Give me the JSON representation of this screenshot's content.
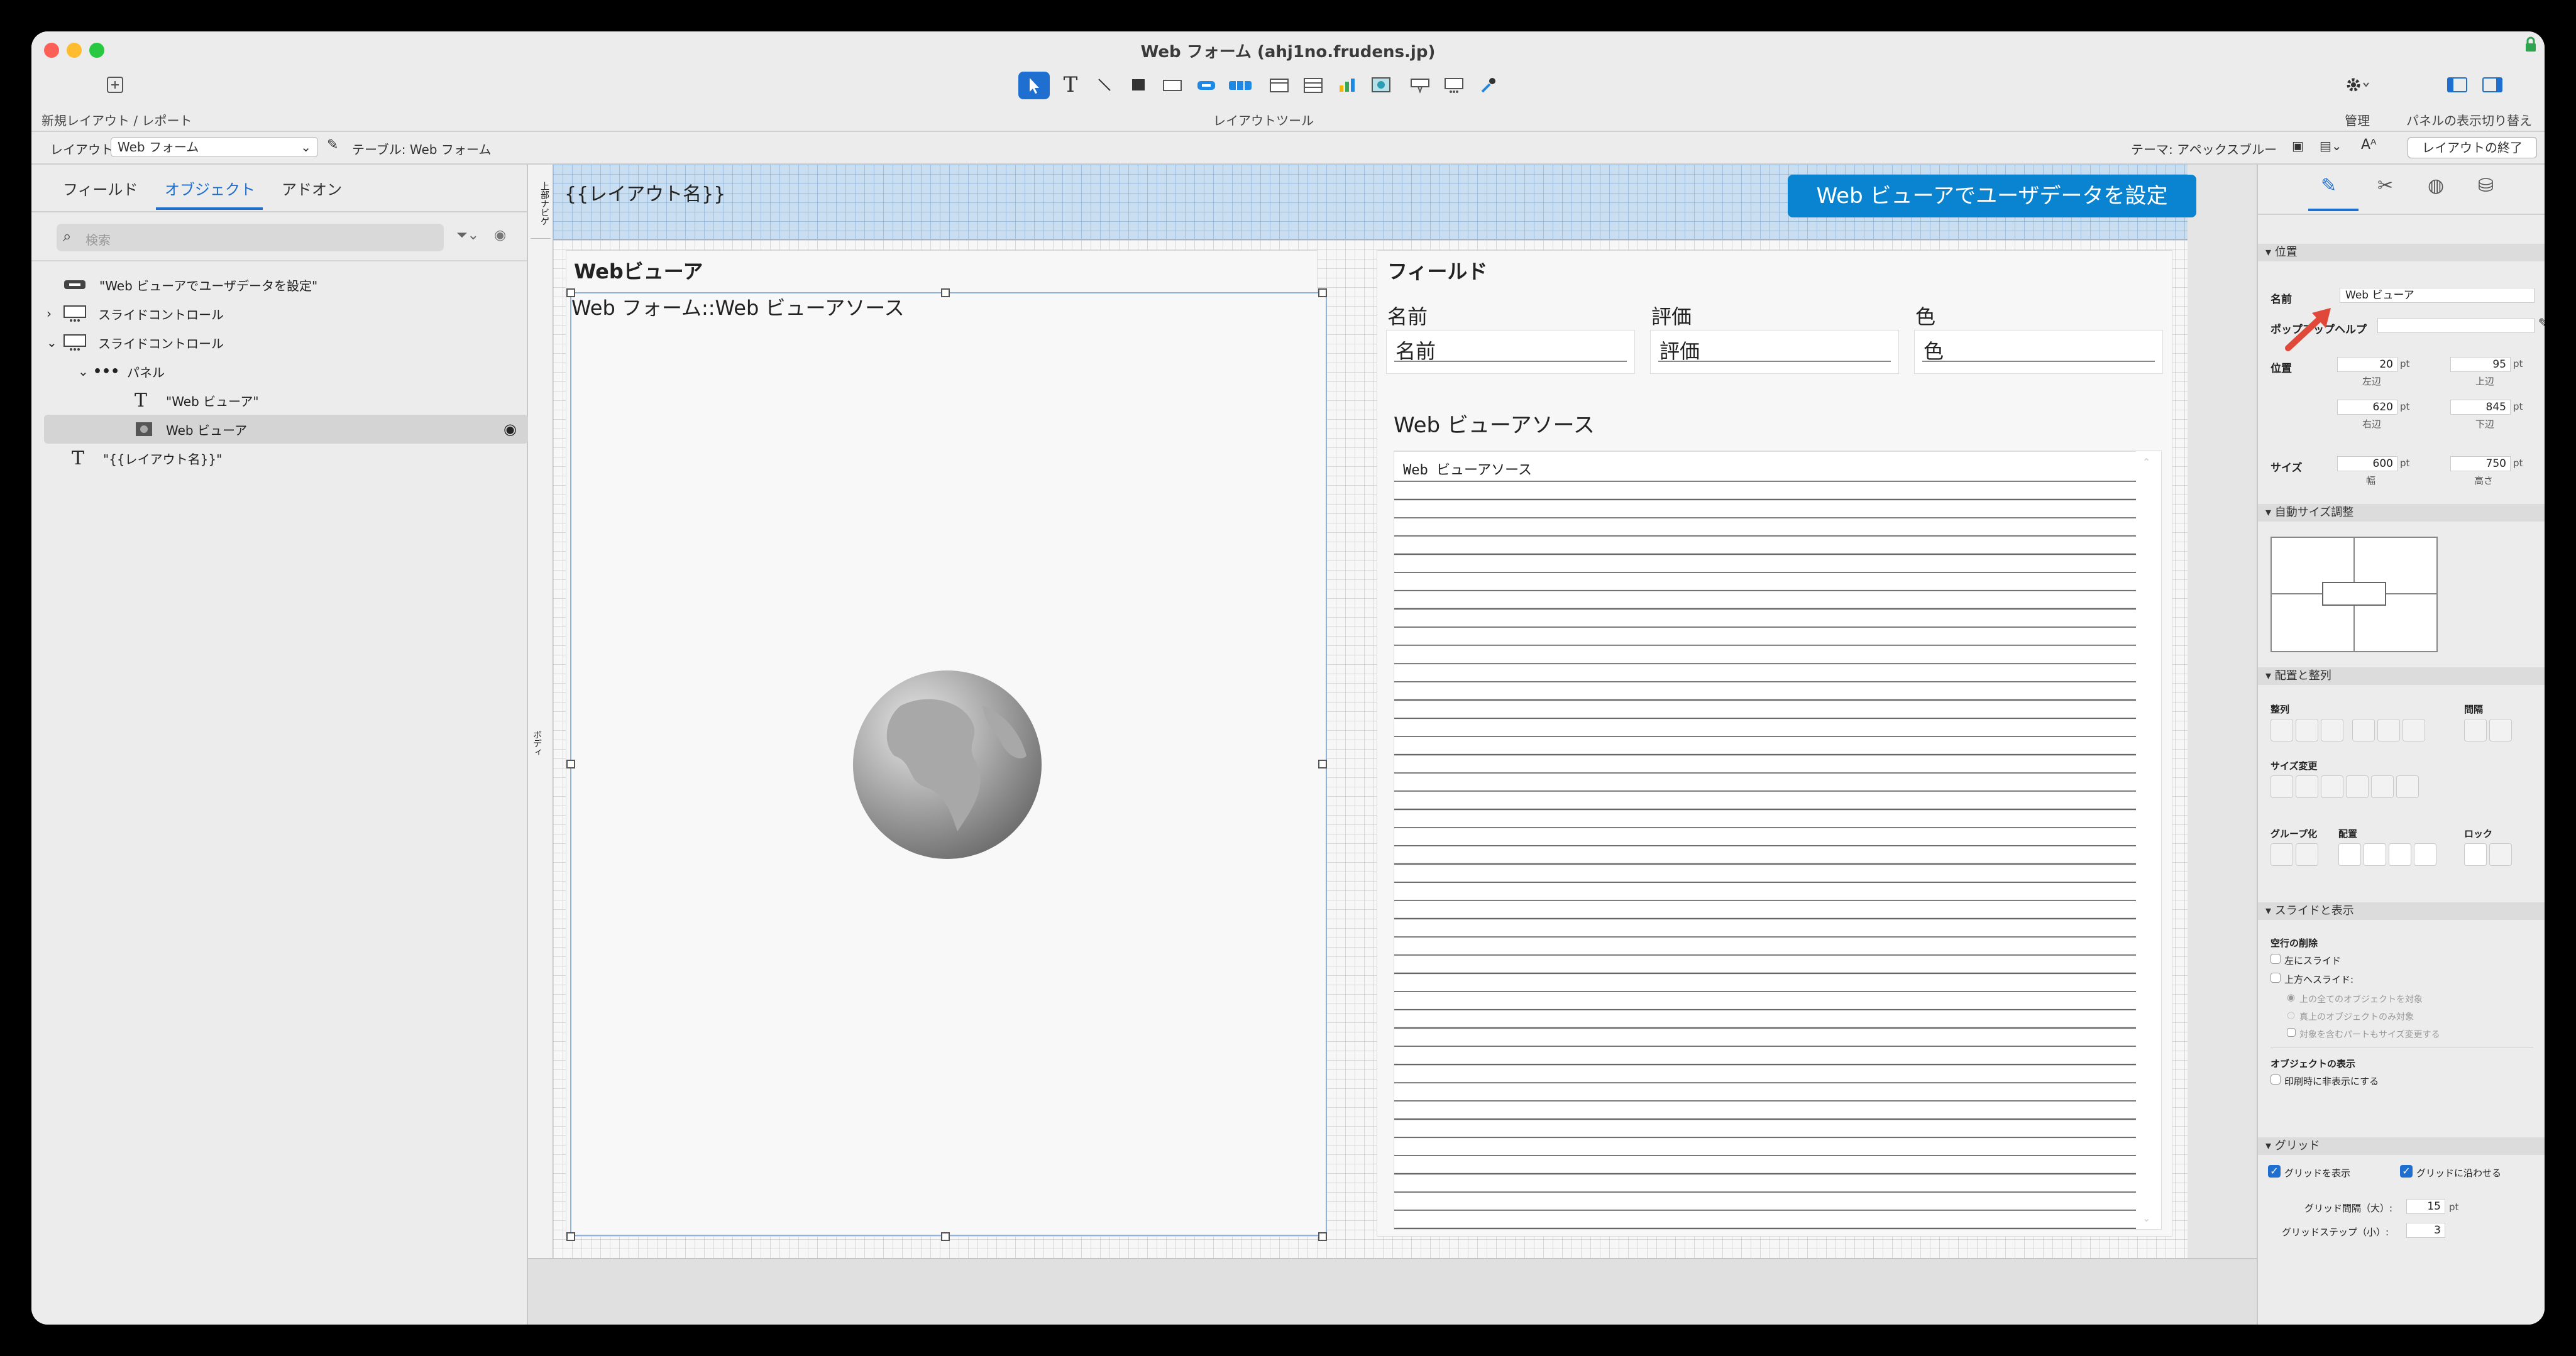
{
  "window": {
    "title": "Web フォーム (ahj1no.frudens.jp)",
    "new_layout_label": "新規レイアウト / レポート",
    "layout_tools_label": "レイアウトツール",
    "manage_label": "管理",
    "panel_toggle_label": "パネルの表示切り替え"
  },
  "layoutbar": {
    "layout_label": "レイアウト:",
    "layout_value": "Web フォーム",
    "table_label": "テーブル: Web フォーム",
    "theme_label": "テーマ: アペックスブルー",
    "end_layout_button": "レイアウトの終了"
  },
  "left_panel": {
    "tabs": [
      "フィールド",
      "オブジェクト",
      "アドオン"
    ],
    "active_tab": "オブジェクト",
    "search_placeholder": "検索",
    "tree": [
      {
        "label": "\"Web ビューアでユーザデータを設定\"",
        "icon": "button-icon"
      },
      {
        "label": "スライドコントロール",
        "icon": "slide-control-icon"
      },
      {
        "label": "スライドコントロール",
        "icon": "slide-control-icon"
      },
      {
        "label": "パネル",
        "icon": "ellipsis-icon"
      },
      {
        "label": "\"Web ビューア\"",
        "icon": "text-icon"
      },
      {
        "label": "Web ビューア",
        "icon": "web-viewer-icon"
      },
      {
        "label": "\"{{レイアウト名}}\"",
        "icon": "text-icon"
      }
    ]
  },
  "canvas": {
    "part_header_label": "上部ナビゲ",
    "part_body_label": "ボディ",
    "layout_name_placeholder": "{{レイアウト名}}",
    "set_user_data_button": "Web ビューアでユーザデータを設定",
    "webviewer_title": "Webビューア",
    "webviewer_source": "Web フォーム::Web ビューアソース",
    "fields_title": "フィールド",
    "field_labels": [
      "名前",
      "評価",
      "色"
    ],
    "field_values": [
      "名前",
      "評価",
      "色"
    ],
    "source_section_title": "Web ビューアソース",
    "source_field_value": "Web ビューアソース"
  },
  "inspector": {
    "section_position": "位置",
    "name_label": "名前",
    "name_value": "Web ビューア",
    "popup_help_label": "ポップアップヘルプ",
    "position_label": "位置",
    "left_value": "20",
    "top_value": "95",
    "right_value": "620",
    "bottom_value": "845",
    "unit": "pt",
    "left_caption": "左辺",
    "top_caption": "上辺",
    "right_caption": "右辺",
    "bottom_caption": "下辺",
    "size_label": "サイズ",
    "width_value": "600",
    "height_value": "750",
    "width_caption": "幅",
    "height_caption": "高さ",
    "section_autosize": "自動サイズ調整",
    "section_arrange": "配置と整列",
    "align_label": "整列",
    "spacing_label": "間隔",
    "resize_label": "サイズ変更",
    "group_label": "グループ化",
    "arrange_label": "配置",
    "lock_label": "ロック",
    "section_slide": "スライドと表示",
    "remove_blank_label": "空行の削除",
    "slide_left": "左にスライド",
    "slide_up": "上方へスライド:",
    "slide_opt1": "上の全てのオブジェクトを対象",
    "slide_opt2": "真上のオブジェクトのみ対象",
    "slide_opt3": "対象を含むパートもサイズ変更する",
    "object_display_label": "オブジェクトの表示",
    "hide_when_printing": "印刷時に非表示にする",
    "section_grid": "グリッド",
    "show_grid": "グリッドを表示",
    "snap_grid": "グリッドに沿わせる",
    "grid_major_label": "グリッド間隔（大）:",
    "grid_major_value": "15",
    "grid_minor_label": "グリッドステップ（小）:",
    "grid_minor_value": "3"
  },
  "colors": {
    "accent": "#1f6fd1",
    "button_blue": "#0a84d0",
    "red_arrow": "#e0493a"
  }
}
